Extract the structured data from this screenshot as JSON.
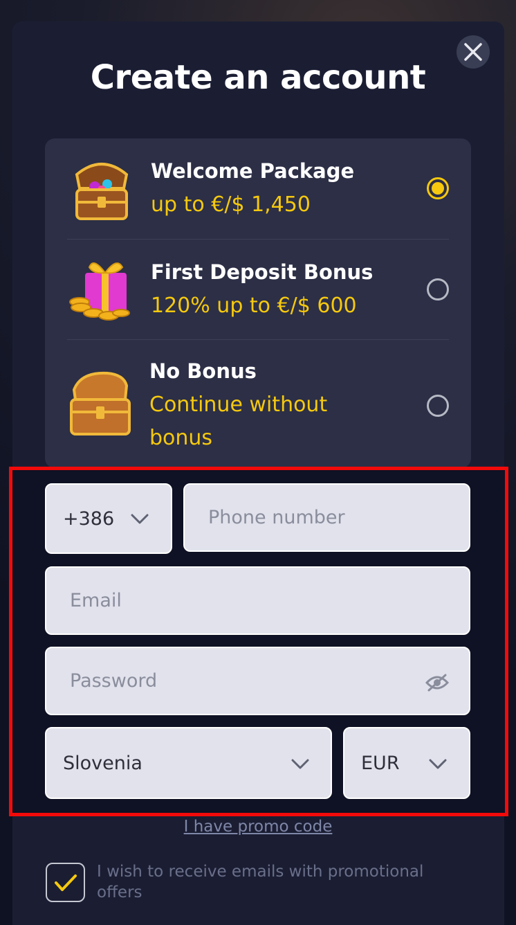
{
  "modal": {
    "title": "Create an account",
    "close_icon": "close-icon"
  },
  "bonuses": [
    {
      "name": "Welcome Package",
      "detail": "up to €/$ 1,450",
      "selected": true,
      "icon": "treasure-chest-gems-icon"
    },
    {
      "name": "First Deposit Bonus",
      "detail": "120% up to €/$ 600",
      "selected": false,
      "icon": "gift-coins-icon"
    },
    {
      "name": "No Bonus",
      "detail_line1": "Continue without",
      "detail_line2": "bonus",
      "selected": false,
      "icon": "empty-chest-icon"
    }
  ],
  "form": {
    "country_code": "+386",
    "phone_placeholder": "Phone number",
    "email_placeholder": "Email",
    "password_placeholder": "Password",
    "country": "Slovenia",
    "currency": "EUR"
  },
  "promo_link": "I have promo code",
  "consent": {
    "checked": true,
    "label": "I wish to receive emails with promotional offers"
  },
  "colors": {
    "accent": "#f6c90e",
    "modal_bg": "#1b1e33",
    "panel_bg": "#2c2f46",
    "highlight_border": "#f20a0a"
  }
}
